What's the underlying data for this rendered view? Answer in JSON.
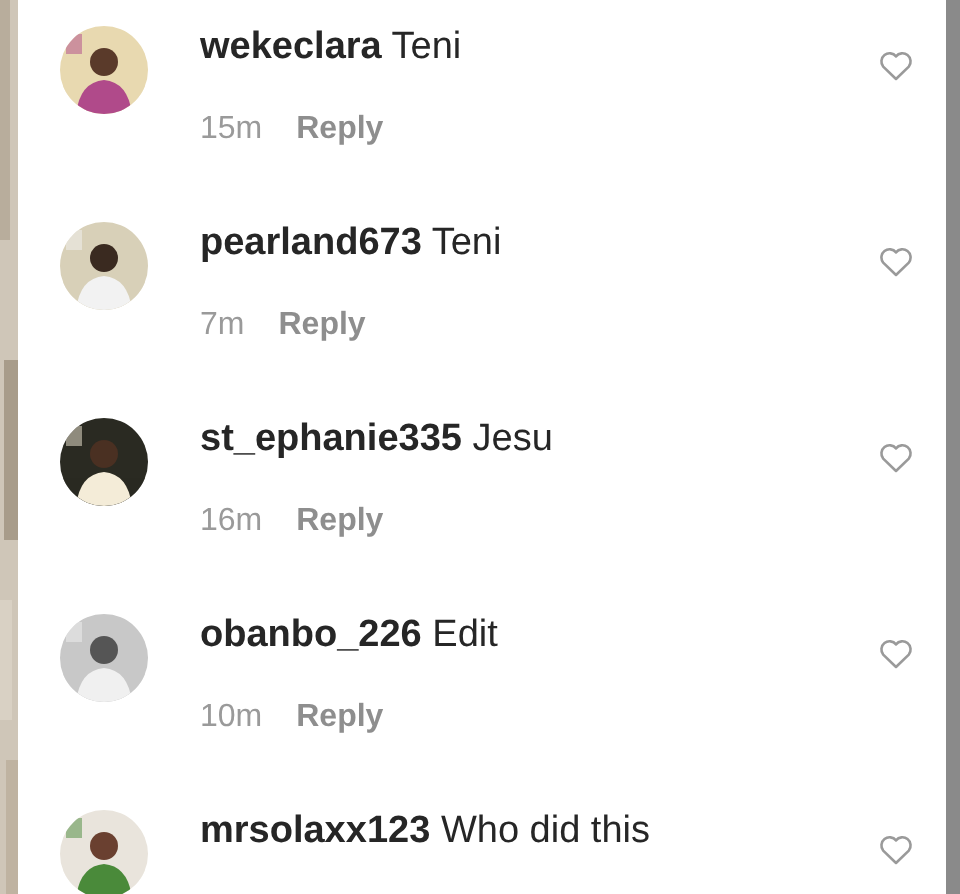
{
  "comments": [
    {
      "username": "wekeclara",
      "text": "Teni",
      "time": "15m",
      "reply": "Reply"
    },
    {
      "username": "pearland673",
      "text": "Teni",
      "time": "7m",
      "reply": "Reply"
    },
    {
      "username": "st_ephanie335",
      "text": "Jesu",
      "time": "16m",
      "reply": "Reply"
    },
    {
      "username": "obanbo_226",
      "text": "Edit",
      "time": "10m",
      "reply": "Reply"
    },
    {
      "username": "mrsolaxx123",
      "text": "Who did this"
    }
  ]
}
